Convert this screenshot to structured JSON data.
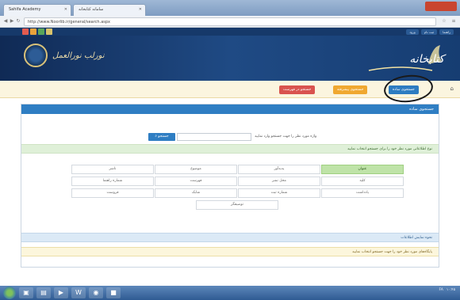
{
  "browser": {
    "tabs": [
      {
        "label": "Sahifa Academy"
      },
      {
        "label": "سامانه کتابخانه"
      }
    ],
    "url": "http://www.Noorlib.ir/general/search.aspx"
  },
  "site": {
    "left_logo_text": "نورلب نورالعمل",
    "right_logo_text": "کتابخانه",
    "top_links": [
      "ورود",
      "ثبت نام",
      "راهنما"
    ]
  },
  "toolbar": {
    "buttons": [
      {
        "label": "جستجوی ساده",
        "color": "#2d7cc1"
      },
      {
        "label": "جستجوی پیشرفته",
        "color": "#f0a830"
      },
      {
        "label": "جستجو در فهرست",
        "color": "#d9534f"
      }
    ]
  },
  "panel": {
    "title": "جستجوی ساده",
    "search_button": "جستجو",
    "search_hint": "واژه مورد نظر را جهت جستجو وارد نمایید",
    "fields_bar": "نوع اطلاعاتی مورد نظر خود را برای جستجو انتخاب نمایید",
    "fields": [
      [
        "عنوان",
        "پدیدآور",
        "موضوع",
        "ناشر",
        "رده‌بندی"
      ],
      [
        "کلید",
        "محل نشر",
        "فهرست",
        "سال نشر",
        "شماره راهنما"
      ],
      [
        "یادداشت",
        "شابک",
        "زبان",
        "شماره ثبت",
        "فروست"
      ],
      [
        "توصیفگر"
      ]
    ],
    "active_field": "عنوان",
    "info_bar": "نحوه نمایش اطلاعات",
    "databases_bar": "پایگاه‌های مورد نظر خود را جهت جستجو انتخاب نمایید"
  },
  "taskbar": {
    "time": "۱۰:۴۵",
    "lang": "FA"
  }
}
